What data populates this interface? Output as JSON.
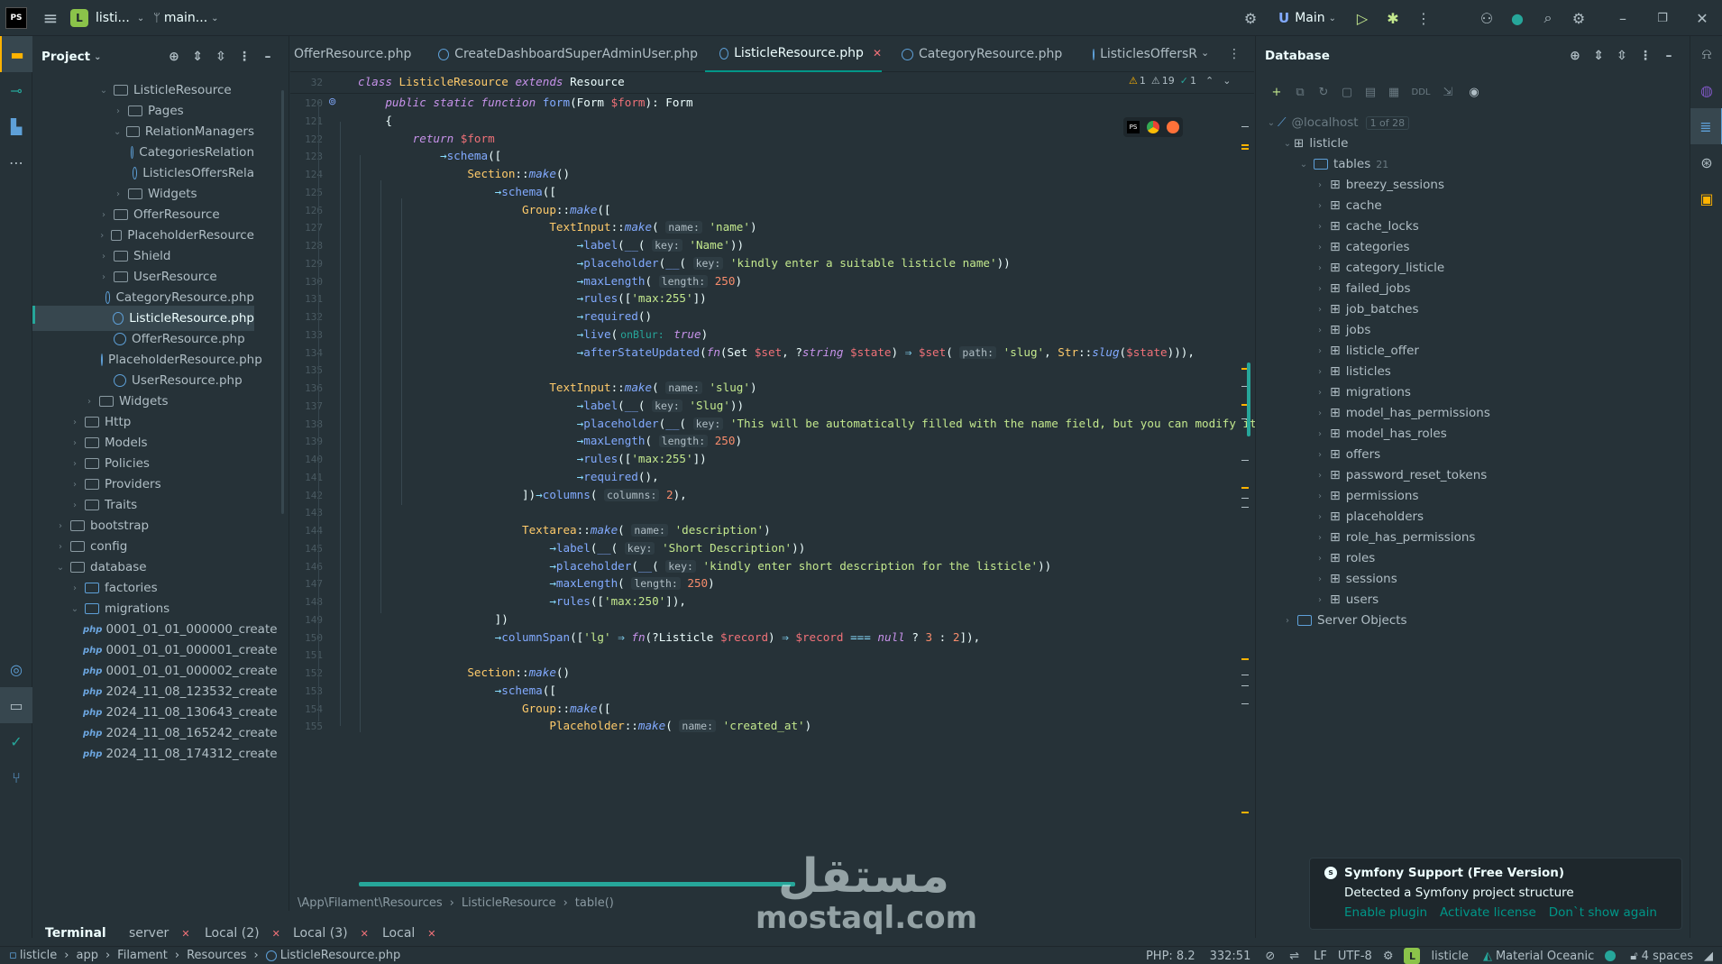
{
  "titlebar": {
    "project_badge": "L",
    "project_name": "listi...",
    "branch": "main...",
    "run_config": "Main"
  },
  "project_panel": {
    "title": "Project",
    "items": [
      {
        "label": "ListicleResource",
        "kind": "folder",
        "open": true
      },
      {
        "label": "Pages",
        "kind": "folder",
        "open": false
      },
      {
        "label": "RelationManagers",
        "kind": "folder",
        "open": true
      },
      {
        "label": "CategoriesRelation",
        "kind": "class"
      },
      {
        "label": "ListiclesOffersRela",
        "kind": "class"
      },
      {
        "label": "Widgets",
        "kind": "folder",
        "open": false
      },
      {
        "label": "OfferResource",
        "kind": "folder",
        "open": false
      },
      {
        "label": "PlaceholderResource",
        "kind": "folder",
        "open": false
      },
      {
        "label": "Shield",
        "kind": "folder",
        "open": false
      },
      {
        "label": "UserResource",
        "kind": "folder",
        "open": false
      },
      {
        "label": "CategoryResource.php",
        "kind": "class"
      },
      {
        "label": "ListicleResource.php",
        "kind": "class",
        "selected": true
      },
      {
        "label": "OfferResource.php",
        "kind": "class"
      },
      {
        "label": "PlaceholderResource.php",
        "kind": "class"
      },
      {
        "label": "UserResource.php",
        "kind": "class"
      },
      {
        "label": "Widgets",
        "kind": "folder",
        "open": false
      },
      {
        "label": "Http",
        "kind": "folder",
        "open": false
      },
      {
        "label": "Models",
        "kind": "folder",
        "open": false
      },
      {
        "label": "Policies",
        "kind": "folder",
        "open": false
      },
      {
        "label": "Providers",
        "kind": "folder",
        "open": false
      },
      {
        "label": "Traits",
        "kind": "folder",
        "open": false
      },
      {
        "label": "bootstrap",
        "kind": "folder",
        "open": false
      },
      {
        "label": "config",
        "kind": "folder",
        "open": false
      },
      {
        "label": "database",
        "kind": "folder",
        "open": true
      },
      {
        "label": "factories",
        "kind": "folder",
        "open": false
      },
      {
        "label": "migrations",
        "kind": "folder",
        "open": true
      },
      {
        "label": "0001_01_01_000000_create",
        "kind": "php"
      },
      {
        "label": "0001_01_01_000001_create",
        "kind": "php"
      },
      {
        "label": "0001_01_01_000002_create",
        "kind": "php"
      },
      {
        "label": "2024_11_08_123532_create",
        "kind": "php"
      },
      {
        "label": "2024_11_08_130643_create",
        "kind": "php"
      },
      {
        "label": "2024_11_08_165242_create",
        "kind": "php"
      },
      {
        "label": "2024_11_08_174312_create",
        "kind": "php"
      }
    ]
  },
  "editor_tabs": [
    {
      "label": "OfferResource.php",
      "active": false
    },
    {
      "label": "CreateDashboardSuperAdminUser.php",
      "active": false
    },
    {
      "label": "ListicleResource.php",
      "active": true
    },
    {
      "label": "CategoryResource.php",
      "active": false
    },
    {
      "label": "ListiclesOffersR",
      "active": false
    }
  ],
  "sticky_header": {
    "line": "32",
    "text": "class ListicleResource extends Resource"
  },
  "inspections": {
    "warnings": "1",
    "weak_warnings": "19",
    "ok": "1"
  },
  "line_numbers": [
    "120",
    "121",
    "122",
    "123",
    "124",
    "125",
    "126",
    "127",
    "128",
    "129",
    "130",
    "131",
    "132",
    "133",
    "134",
    "135",
    "136",
    "137",
    "138",
    "139",
    "140",
    "141",
    "142",
    "143",
    "144",
    "145",
    "146",
    "147",
    "148",
    "149",
    "150",
    "151",
    "152",
    "153",
    "154",
    "155"
  ],
  "breadcrumb": [
    "\\App\\Filament\\Resources",
    "ListicleResource",
    "table()"
  ],
  "database_panel": {
    "title": "Database",
    "host": "@localhost",
    "host_badge": "1 of 28",
    "schema": "listicle",
    "tables_label": "tables",
    "tables_count": "21",
    "tables": [
      "breezy_sessions",
      "cache",
      "cache_locks",
      "categories",
      "category_listicle",
      "failed_jobs",
      "job_batches",
      "jobs",
      "listicle_offer",
      "listicles",
      "migrations",
      "model_has_permissions",
      "model_has_roles",
      "offers",
      "password_reset_tokens",
      "permissions",
      "placeholders",
      "role_has_permissions",
      "roles",
      "sessions",
      "users"
    ],
    "server_objects": "Server Objects",
    "toolbar_ddl": "DDL"
  },
  "notification": {
    "title": "Symfony Support (Free Version)",
    "body": "Detected a Symfony project structure",
    "actions": [
      "Enable plugin",
      "Activate license",
      "Don`t show again"
    ]
  },
  "bottom_tabs": [
    "Terminal",
    "server",
    "Local (2)",
    "Local (3)",
    "Local"
  ],
  "statusbar": {
    "path": [
      "listicle",
      "app",
      "Filament",
      "Resources",
      "ListicleResource.php"
    ],
    "php": "PHP: 8.2",
    "position": "332:51",
    "line_sep": "LF",
    "encoding": "UTF-8",
    "project_badge": "L",
    "project": "listicle",
    "theme": "Material Oceanic",
    "indent": "4 spaces"
  },
  "watermark": {
    "arabic": "مستقل",
    "site": "mostaql.com"
  }
}
